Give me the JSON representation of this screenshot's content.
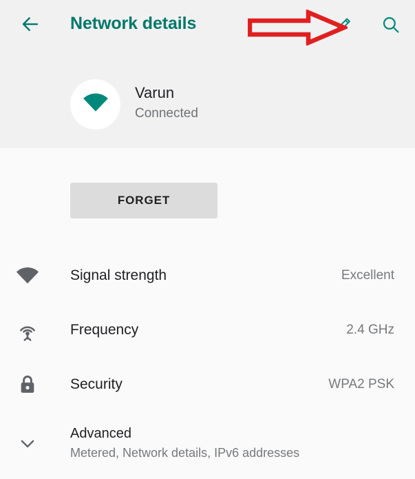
{
  "appbar": {
    "back_icon": "arrow-left-icon",
    "title": "Network details",
    "edit_icon": "pencil-edit-icon",
    "search_icon": "search-icon",
    "accent_color": "#00786a"
  },
  "annotation": {
    "type": "arrow-right-outline",
    "color": "#e02020",
    "points_to": "edit-button"
  },
  "network": {
    "icon": "wifi-signal-icon",
    "name": "Varun",
    "status": "Connected"
  },
  "actions": {
    "forget_label": "FORGET"
  },
  "details": [
    {
      "icon": "wifi-signal-icon",
      "label": "Signal strength",
      "value": "Excellent"
    },
    {
      "icon": "antenna-frequency-icon",
      "label": "Frequency",
      "value": "2.4 GHz"
    },
    {
      "icon": "lock-icon",
      "label": "Security",
      "value": "WPA2 PSK"
    }
  ],
  "advanced": {
    "icon": "chevron-down-icon",
    "title": "Advanced",
    "subtitle": "Metered, Network details, IPv6 addresses"
  },
  "colors": {
    "header_background": "#f1f1f2",
    "body_background": "#fafafa",
    "teal": "#00786a",
    "icon_gray": "#5f6368",
    "secondary_text": "#76797c"
  }
}
